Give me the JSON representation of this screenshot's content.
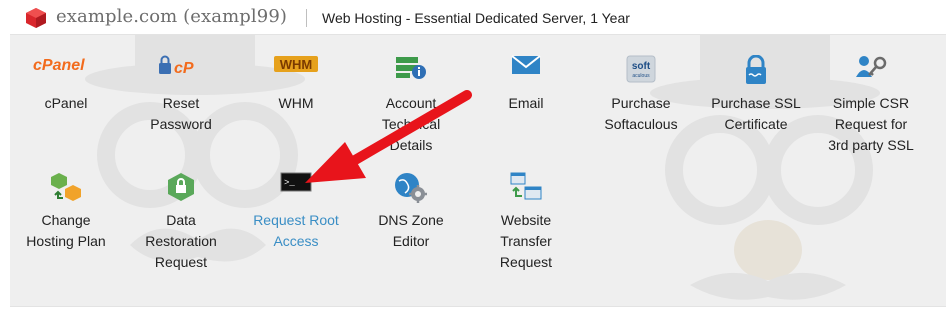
{
  "header": {
    "site": "example.com (exampl99)",
    "plan": "Web Hosting - Essential Dedicated Server, 1 Year"
  },
  "icons": {
    "brand": "red-cube-icon",
    "cpanel": "cpanel-logo-icon",
    "reset_password": "lock-cpanel-icon",
    "whm": "whm-logo-icon",
    "account_details": "server-info-icon",
    "email": "envelope-icon",
    "softaculous": "softaculous-icon",
    "ssl": "padlock-certificate-icon",
    "csr": "user-key-icon",
    "change_plan": "cubes-swap-icon",
    "data_restoration": "hexagon-lock-icon",
    "root_access": "terminal-icon",
    "dns": "globe-gear-icon",
    "transfer": "windows-transfer-icon"
  },
  "tiles": [
    {
      "label": "cPanel"
    },
    {
      "label": "Reset\nPassword"
    },
    {
      "label": "WHM"
    },
    {
      "label": "Account\nTechnical\nDetails"
    },
    {
      "label": "Email"
    },
    {
      "label": "Purchase\nSoftaculous"
    },
    {
      "label": "Purchase SSL\nCertificate"
    },
    {
      "label": "Simple CSR\nRequest for\n3rd party SSL"
    },
    {
      "label": "Change\nHosting Plan"
    },
    {
      "label": "Data\nRestoration\nRequest"
    },
    {
      "label": "Request Root\nAccess"
    },
    {
      "label": "DNS Zone\nEditor"
    },
    {
      "label": "Website\nTransfer\nRequest"
    }
  ],
  "logo_text": {
    "cpanel": "cPanel",
    "whm": "WHM",
    "soft": "soft",
    "soft_sub": "aculous",
    "term": ">_"
  },
  "colors": {
    "brand_red": "#d9262c",
    "link_blue": "#3a8ec5",
    "arrow_red": "#e8141b"
  }
}
